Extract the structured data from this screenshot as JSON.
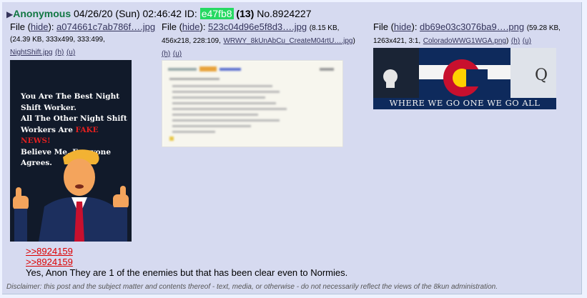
{
  "post": {
    "name": "Anonymous",
    "datetime": "04/26/20 (Sun) 02:46:42",
    "id_label": "ID:",
    "id_value": "e47fb8",
    "id_count": "(13)",
    "number": "No.8924227"
  },
  "files": [
    {
      "label": "File",
      "hide": "hide",
      "name": "a074661c7ab786f….jpg",
      "meta": "(24.39 KB, 333x499, 333:499,",
      "orig": "NightShift.jpg",
      "h": "(h)",
      "u": "(u)",
      "meme_lines": [
        "You Are The Best Night",
        "Shift Worker.",
        "All The Other Night Shift",
        "Workers Are"
      ],
      "meme_red": "FAKE",
      "meme_red2": "NEWS!",
      "meme_lines2": [
        "Believe Me. Everyone",
        "Agrees."
      ]
    },
    {
      "label": "File",
      "hide": "hide",
      "name": "523c04d96e5f8d3….jpg",
      "meta": "(8.15 KB,",
      "meta2": "456x218, 228:109,",
      "orig": "WRWY_8kUnAbCu_CreateM04rtU….jpg",
      "close": ")",
      "h": "(h)",
      "u": "(u)"
    },
    {
      "label": "File",
      "hide": "hide",
      "name": "db69e03c3076ba9….png",
      "meta": "(59.28 KB,",
      "meta2": "1263x421, 3:1,",
      "orig": "ColoradoWWG1WGA.png",
      "close": ")",
      "h": "(h)",
      "u": "(u)",
      "banner_text": "WHERE WE GO ONE WE GO ALL",
      "q_letter": "Q"
    }
  ],
  "quotes": [
    ">>8924159",
    ">>8924159"
  ],
  "body": "Yes, Anon They are 1 of the enemies but that has been clear even to Normies.",
  "disclaimer": "Disclaimer: this post and the subject matter and contents thereof - text, media, or otherwise - do not necessarily reflect the views of the 8kun administration."
}
